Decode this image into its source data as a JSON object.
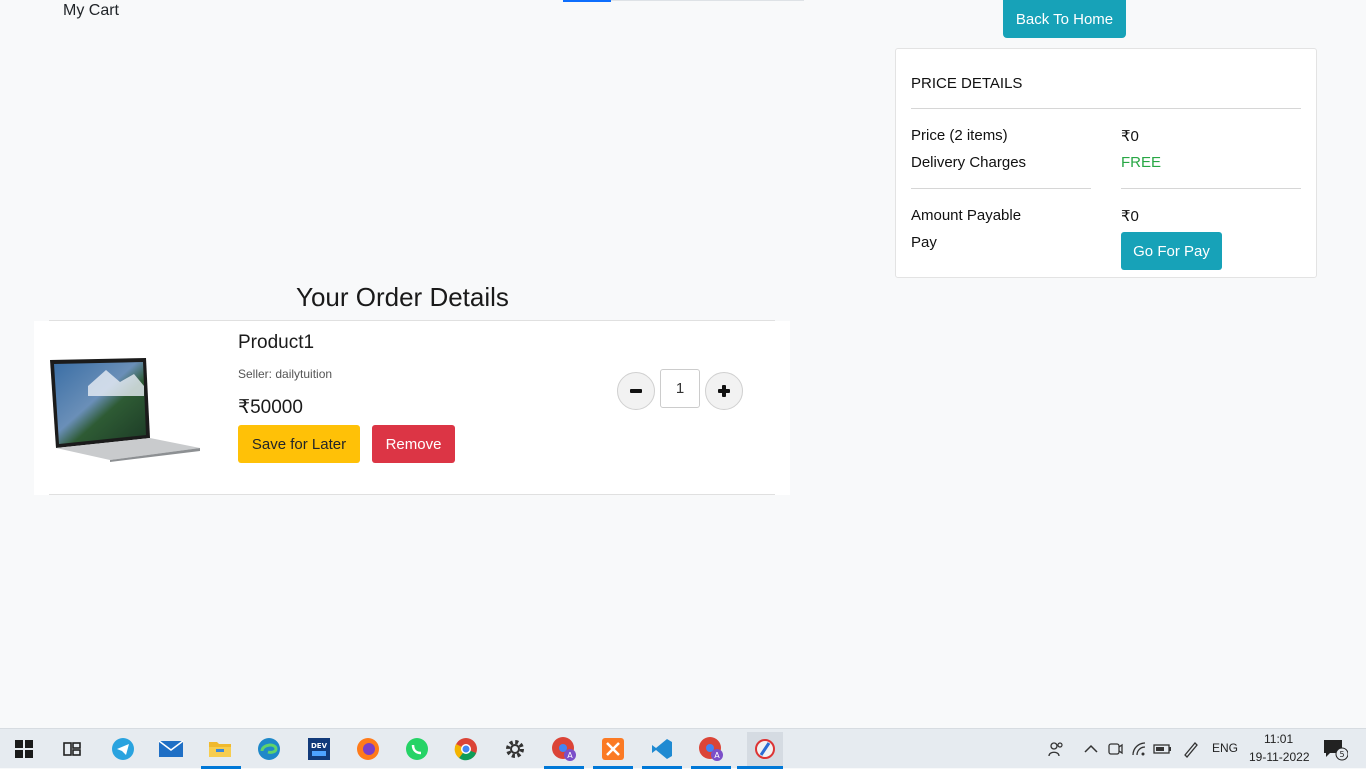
{
  "header": {
    "cart_label": "My Cart",
    "back_button": "Back To Home"
  },
  "price_details": {
    "title": "PRICE DETAILS",
    "price_label": "Price (2 items)",
    "price_value": "₹0",
    "delivery_label": "Delivery Charges",
    "delivery_value": "FREE",
    "amount_label": "Amount Payable",
    "amount_value": "₹0",
    "pay_label": "Pay",
    "pay_button": "Go For Pay",
    "free_color": "#28a745",
    "accent": "#17a2b8"
  },
  "order": {
    "title": "Your Order Details",
    "item": {
      "name": "Product1",
      "seller": "Seller: dailytuition",
      "price": "₹50000",
      "quantity": "1",
      "save_button": "Save for Later",
      "remove_button": "Remove"
    }
  },
  "taskbar": {
    "apps": [
      "start-icon",
      "task-view-icon",
      "telegram-icon",
      "mail-icon",
      "file-explorer-icon",
      "edge-icon",
      "dev-icon",
      "firefox-icon",
      "whatsapp-icon",
      "chrome-icon",
      "settings-icon",
      "chrome-profile-icon",
      "xampp-icon",
      "vscode-icon",
      "chrome-profile-icon-2",
      "paint-icon"
    ],
    "language": "ENG",
    "time": "11:01",
    "date": "19-11-2022",
    "notifications": "5"
  }
}
